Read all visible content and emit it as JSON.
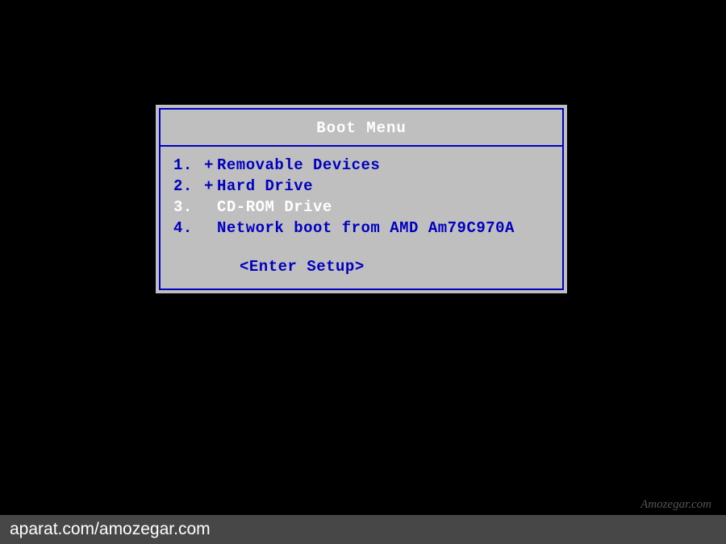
{
  "boot_menu": {
    "title": "Boot Menu",
    "items": [
      {
        "number": "1.",
        "prefix": "+",
        "label": "Removable Devices",
        "selected": false
      },
      {
        "number": "2.",
        "prefix": "+",
        "label": "Hard Drive",
        "selected": false
      },
      {
        "number": "3.",
        "prefix": "",
        "label": "CD-ROM Drive",
        "selected": true
      },
      {
        "number": "4.",
        "prefix": "",
        "label": "Network boot from AMD Am79C970A",
        "selected": false
      }
    ],
    "enter_setup": "<Enter Setup>"
  },
  "watermark": {
    "right": "Amozegar.com",
    "bottom": "aparat.com/amozegar.com"
  }
}
